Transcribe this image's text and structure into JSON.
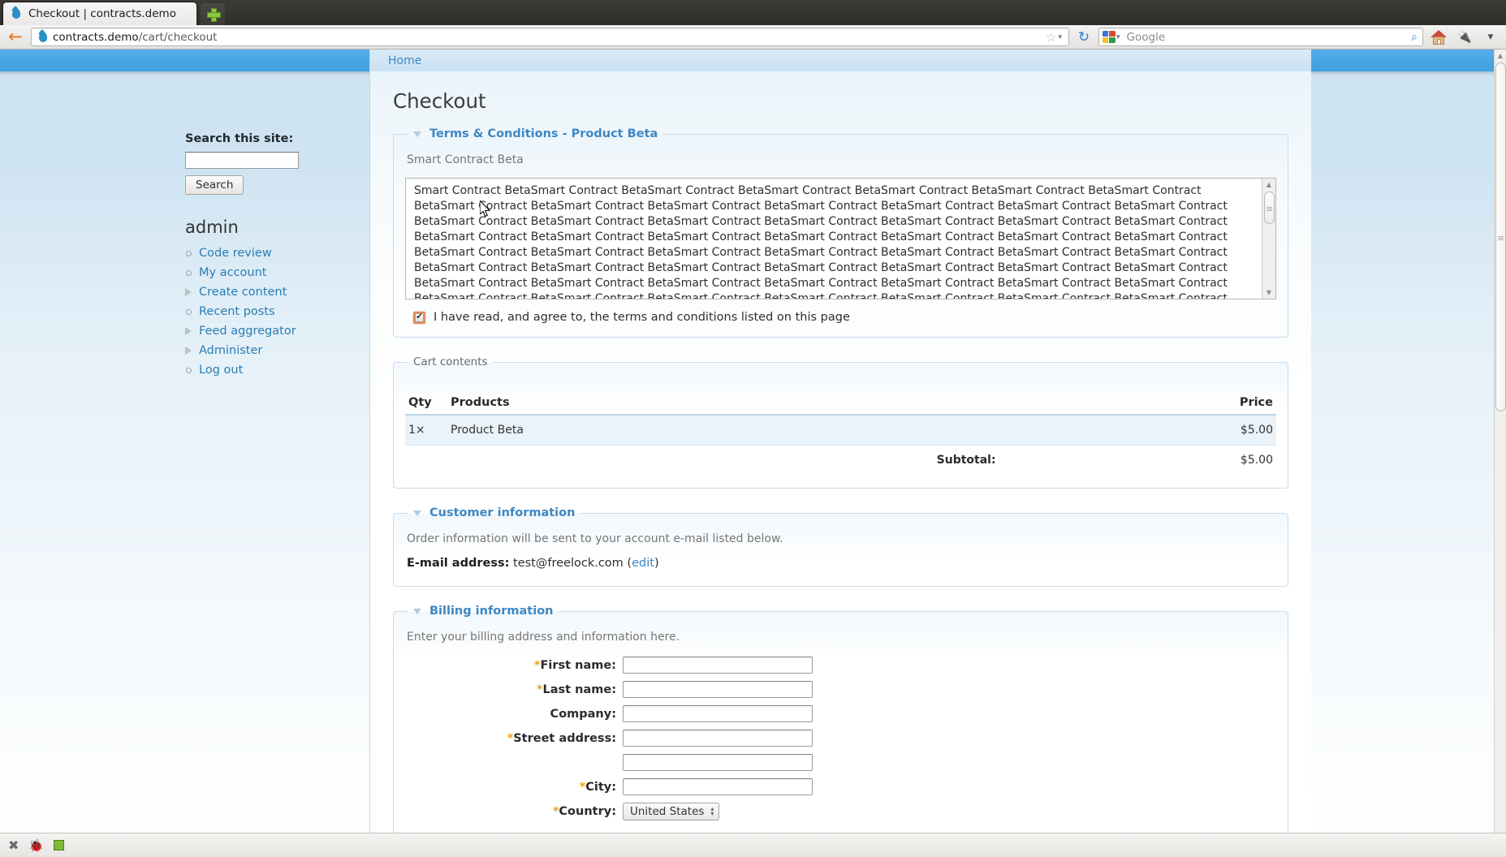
{
  "browser": {
    "tab": {
      "title": "Checkout | contracts.demo",
      "favicon": "drupal-drop-icon"
    },
    "new_tab_label": "+",
    "back_label": "←",
    "url": {
      "host": "contracts.demo",
      "path": "/cart/checkout"
    },
    "bookmark_icon": "star-icon",
    "bookmark_caret": "▾",
    "reload_icon": "↻",
    "search": {
      "engine": "Google",
      "placeholder": "Google",
      "caret": "▾",
      "go_icon": "⌕"
    },
    "toolbar_icons": [
      "home-icon",
      "plug-icon",
      "menu-caret-icon"
    ],
    "statusbar_icons": [
      "close-icon",
      "firebug-icon",
      "green-square-icon"
    ]
  },
  "breadcrumb": {
    "home": "Home"
  },
  "sidebar": {
    "search_block": {
      "title": "Search this site:",
      "input_value": "",
      "button_label": "Search"
    },
    "menu_heading": "admin",
    "items": [
      {
        "label": "Code review",
        "marker": "circle"
      },
      {
        "label": "My account",
        "marker": "circle"
      },
      {
        "label": "Create content",
        "marker": "triangle"
      },
      {
        "label": "Recent posts",
        "marker": "circle"
      },
      {
        "label": "Feed aggregator",
        "marker": "triangle"
      },
      {
        "label": "Administer",
        "marker": "triangle"
      },
      {
        "label": "Log out",
        "marker": "circle"
      }
    ]
  },
  "page": {
    "title": "Checkout",
    "terms": {
      "legend": "Terms & Conditions - Product Beta",
      "subtitle": "Smart Contract Beta",
      "body": "Smart Contract BetaSmart Contract BetaSmart Contract BetaSmart Contract BetaSmart Contract BetaSmart Contract BetaSmart Contract BetaSmart Contract BetaSmart Contract BetaSmart Contract BetaSmart Contract BetaSmart Contract BetaSmart Contract BetaSmart Contract BetaSmart Contract BetaSmart Contract BetaSmart Contract BetaSmart Contract BetaSmart Contract BetaSmart Contract BetaSmart Contract BetaSmart Contract BetaSmart Contract BetaSmart Contract BetaSmart Contract BetaSmart Contract BetaSmart Contract BetaSmart Contract BetaSmart Contract BetaSmart Contract BetaSmart Contract BetaSmart Contract BetaSmart Contract BetaSmart Contract BetaSmart Contract BetaSmart Contract BetaSmart Contract BetaSmart Contract BetaSmart Contract BetaSmart Contract BetaSmart Contract BetaSmart Contract BetaSmart Contract BetaSmart Contract BetaSmart Contract BetaSmart Contract BetaSmart Contract BetaSmart Contract BetaSmart Contract BetaSmart Contract BetaSmart Contract BetaSmart Contract BetaSmart Contract BetaSmart Contract BetaSmart Contract BetaSmart Contract BetaSmart Contract BetaSmart Contract BetaSmart Contract BetaSmart Contract BetaSmart",
      "checkbox_checked": true,
      "checkbox_state_color": "#e8895a",
      "agree_label": "I have read, and agree to, the terms and conditions listed on this page"
    },
    "cart": {
      "legend": "Cart contents",
      "columns": [
        "Qty",
        "Products",
        "Price"
      ],
      "rows": [
        {
          "qty": "1×",
          "product": "Product Beta",
          "price": "$5.00"
        }
      ],
      "subtotal_label": "Subtotal:",
      "subtotal_value": "$5.00"
    },
    "customer": {
      "legend": "Customer information",
      "description": "Order information will be sent to your account e-mail listed below.",
      "email_label": "E-mail address:",
      "email_value": "test@freelock.com",
      "edit_open": "(",
      "edit_label": "edit",
      "edit_close": ")"
    },
    "billing": {
      "legend": "Billing information",
      "description": "Enter your billing address and information here.",
      "fields": [
        {
          "label": "First name:",
          "required": true,
          "type": "text",
          "value": ""
        },
        {
          "label": "Last name:",
          "required": true,
          "type": "text",
          "value": ""
        },
        {
          "label": "Company:",
          "required": false,
          "type": "text",
          "value": ""
        },
        {
          "label": "Street address:",
          "required": true,
          "type": "text",
          "value": ""
        },
        {
          "label": "",
          "required": false,
          "type": "text",
          "value": ""
        },
        {
          "label": "City:",
          "required": true,
          "type": "text",
          "value": ""
        },
        {
          "label": "Country:",
          "required": true,
          "type": "select",
          "value": "United States"
        }
      ]
    }
  },
  "colors": {
    "header_blue": "#3e9fe0",
    "link_blue": "#3d87c4",
    "required_orange": "#f3a11c",
    "error_orange": "#e8895a"
  }
}
